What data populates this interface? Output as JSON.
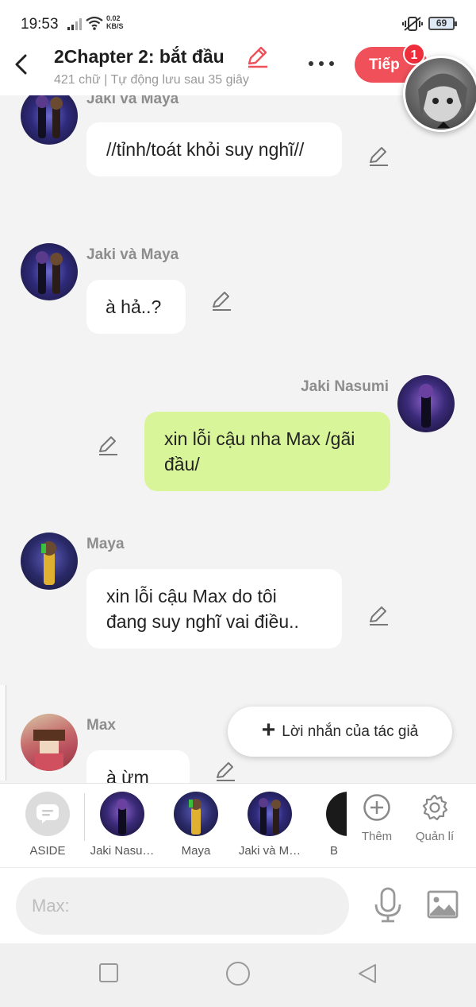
{
  "status_bar": {
    "time": "19:53",
    "net_speed_value": "0.02",
    "net_speed_unit": "KB/S",
    "battery": "69"
  },
  "header": {
    "title": "2Chapter 2: bắt đầu",
    "subtitle": "421 chữ | Tự động lưu sau 35 giây",
    "next_label": "Tiếp",
    "notification_count": "1"
  },
  "messages": [
    {
      "sender": "Jaki và Maya",
      "text": "//tỉnh/toát khỏi suy nghĩ//",
      "mine": false
    },
    {
      "sender": "Jaki và Maya",
      "text": "à hả..?",
      "mine": false
    },
    {
      "sender": "Jaki Nasumi",
      "text": "xin lỗi cậu nha Max /gãi đầu/",
      "mine": true
    },
    {
      "sender": "Maya",
      "text": "xin lỗi cậu Max do tôi đang suy nghĩ vai điều..",
      "mine": false
    },
    {
      "sender": "Max",
      "text": "à ừm",
      "mine": false
    }
  ],
  "author_note": {
    "label": "Lời nhắn của tác giả"
  },
  "characters": [
    {
      "label": "ASIDE"
    },
    {
      "label": "Jaki Nasu…"
    },
    {
      "label": "Maya"
    },
    {
      "label": "Jaki và M…"
    },
    {
      "label": "B"
    }
  ],
  "tools": {
    "add_label": "Thêm",
    "manage_label": "Quản lí"
  },
  "input": {
    "placeholder": "Max:"
  },
  "colors": {
    "accent": "#f0505a",
    "my_bubble": "#d9f59a",
    "other_bubble": "#ffffff",
    "background": "#f3f3f3"
  }
}
